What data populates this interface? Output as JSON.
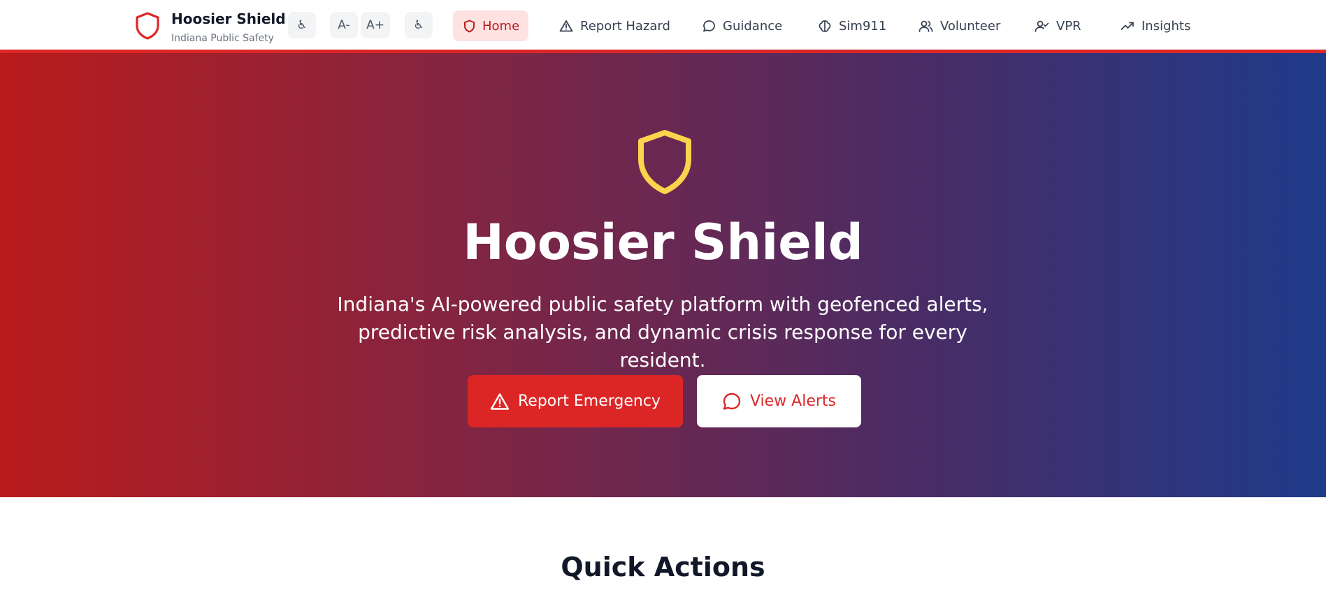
{
  "app": {
    "name": "Hoosier Shield",
    "subtitle": "Indiana Public Safety"
  },
  "toolbar": [
    {
      "label": "♿",
      "icon": "accessibility-icon"
    },
    {
      "label": "A-",
      "icon": "decrease-font"
    },
    {
      "label": "A+",
      "icon": "increase-font"
    },
    {
      "label": "♿",
      "icon": "accessibility-icon"
    }
  ],
  "nav": [
    {
      "label": "Home",
      "icon": "shield-icon",
      "active": true
    },
    {
      "label": "Report Hazard",
      "icon": "warning-triangle-icon"
    },
    {
      "label": "Guidance",
      "icon": "chat-bubble-icon"
    },
    {
      "label": "Sim911",
      "icon": "brain-icon"
    },
    {
      "label": "Volunteer",
      "icon": "users-icon"
    },
    {
      "label": "VPR",
      "icon": "user-check-icon"
    },
    {
      "label": "Insights",
      "icon": "trending-up-icon"
    }
  ],
  "hero": {
    "title": "Hoosier Shield",
    "description": "Indiana's AI-powered public safety platform with geofenced alerts, predictive risk analysis, and dynamic crisis response for every resident.",
    "primary_button": "Report Emergency",
    "secondary_button": "View Alerts"
  },
  "quick_actions": {
    "title": "Quick Actions"
  },
  "colors": {
    "accent": "#dc2626",
    "hero_gradient_start": "#b91c1c",
    "hero_gradient_end": "#1e3a8a",
    "hero_icon": "#fcd34d"
  }
}
